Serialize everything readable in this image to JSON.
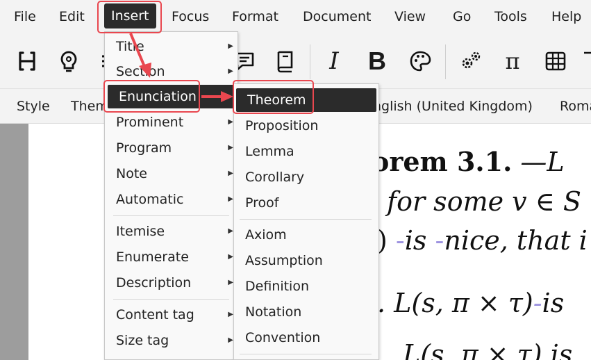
{
  "menubar": {
    "items": [
      "File",
      "Edit",
      "Insert",
      "Focus",
      "Format",
      "Document",
      "View",
      "Go",
      "Tools",
      "Help"
    ]
  },
  "toolbar": {
    "icons": [
      "heading-icon",
      "lightbulb-icon",
      "list-icon",
      "comment-icon",
      "book-icon",
      "italic-icon",
      "bold-icon",
      "palette-icon",
      "gears-icon",
      "pi-icon",
      "table-icon",
      "more-icon"
    ],
    "italic_glyph": "I",
    "bold_glyph": "B",
    "pi_glyph": "π"
  },
  "formatbar": {
    "style_label": "Style",
    "theme_label": "Them",
    "language": "nglish (United Kingdom)",
    "font": "Roma"
  },
  "document": {
    "line1_bold": "orem 3.1.",
    "line1_rest": " —L",
    "line2": "for some v ∈ S",
    "line3_a": ")",
    "line3_is": "is",
    "line3_b": "nice, that i",
    "line4_a": ".  L(s, π × τ)",
    "line4_b": "is",
    "line5": "L(s, π × τ)  is"
  },
  "insert_menu": {
    "items": [
      "Title",
      "Section",
      "Enunciation",
      "Prominent",
      "Program",
      "Note",
      "Automatic",
      "Itemise",
      "Enumerate",
      "Description",
      "Content tag",
      "Size tag"
    ]
  },
  "enunciation_menu": {
    "items": [
      "Theorem",
      "Proposition",
      "Lemma",
      "Corollary",
      "Proof",
      "Axiom",
      "Assumption",
      "Definition",
      "Notation",
      "Convention"
    ]
  },
  "colors": {
    "highlight_red": "#e9474f",
    "selection_dark": "#2b2b2b",
    "gutter_gray": "#9d9d9d"
  }
}
